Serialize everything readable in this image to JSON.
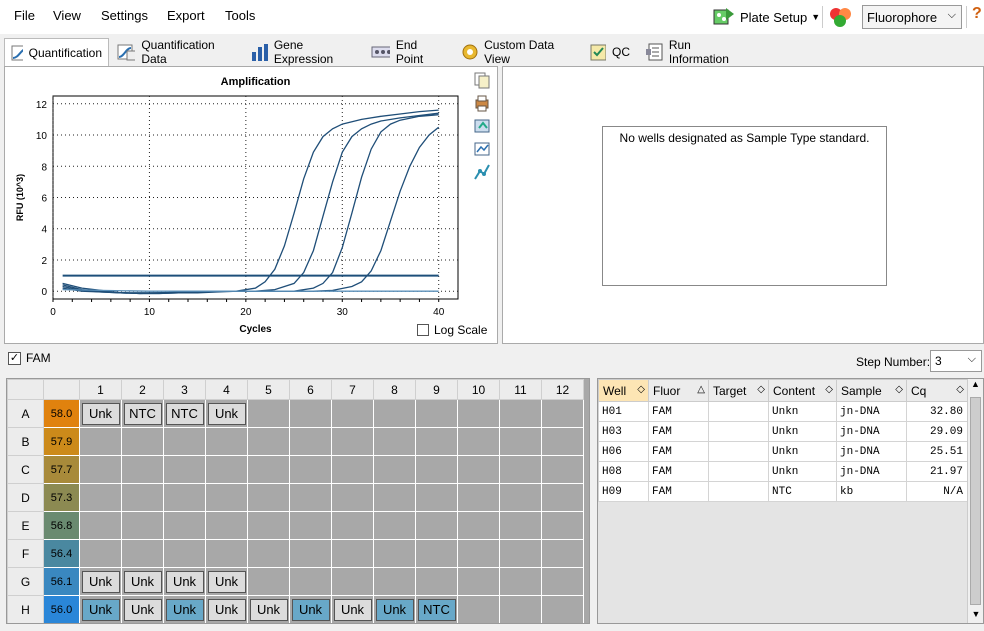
{
  "menu": {
    "items": [
      "File",
      "View",
      "Settings",
      "Export",
      "Tools"
    ]
  },
  "toolbar": {
    "plate_setup": "Plate Setup",
    "fluorophore": "Fluorophore",
    "help": "?"
  },
  "tabs": [
    "Quantification",
    "Quantification Data",
    "Gene Expression",
    "End Point",
    "Custom Data View",
    "QC",
    "Run Information"
  ],
  "chart": {
    "title": "Amplification",
    "xlabel": "Cycles",
    "ylabel": "RFU (10^3)",
    "log_scale": "Log Scale"
  },
  "chart_data": {
    "type": "line",
    "title": "Amplification",
    "xlabel": "Cycles",
    "ylabel": "RFU (10^3)",
    "xlim": [
      0,
      42
    ],
    "ylim": [
      -0.5,
      12.5
    ],
    "xticks": [
      0,
      10,
      20,
      30,
      40
    ],
    "yticks": [
      0,
      2,
      4,
      6,
      8,
      10,
      12
    ],
    "threshold": 1.0,
    "series": [
      {
        "x": [
          1,
          3,
          5,
          7,
          9,
          11,
          13,
          15,
          17,
          19,
          21,
          22,
          23,
          24,
          25,
          26,
          27,
          28,
          29,
          30,
          32,
          34,
          36,
          38,
          40
        ],
        "y": [
          0.5,
          0.2,
          0.05,
          -0.1,
          -0.15,
          -0.15,
          -0.1,
          -0.1,
          -0.05,
          0,
          0.2,
          0.6,
          1.4,
          2.9,
          5.0,
          7.2,
          8.9,
          9.9,
          10.4,
          10.7,
          11.0,
          11.2,
          11.35,
          11.5,
          11.6
        ]
      },
      {
        "x": [
          1,
          3,
          5,
          7,
          9,
          11,
          13,
          15,
          17,
          19,
          21,
          23,
          25,
          26,
          27,
          28,
          29,
          30,
          31,
          32,
          33,
          34,
          36,
          38,
          40
        ],
        "y": [
          0.4,
          0.1,
          0,
          -0.1,
          -0.15,
          -0.15,
          -0.1,
          -0.05,
          0,
          0,
          0,
          0.1,
          0.5,
          1.2,
          2.6,
          4.8,
          7.0,
          8.9,
          9.9,
          10.4,
          10.7,
          10.9,
          11.1,
          11.25,
          11.4
        ]
      },
      {
        "x": [
          1,
          3,
          5,
          7,
          9,
          11,
          13,
          15,
          17,
          19,
          21,
          23,
          25,
          27,
          28,
          29,
          30,
          31,
          32,
          33,
          34,
          35,
          36,
          38,
          40
        ],
        "y": [
          0.3,
          0.05,
          -0.05,
          -0.1,
          -0.15,
          -0.1,
          -0.1,
          -0.05,
          0,
          0,
          0,
          0,
          0,
          0.2,
          0.5,
          1.2,
          2.8,
          5.0,
          7.3,
          9.1,
          10.2,
          10.7,
          10.95,
          11.2,
          11.3
        ]
      },
      {
        "x": [
          1,
          3,
          5,
          7,
          9,
          11,
          13,
          15,
          17,
          19,
          21,
          23,
          25,
          27,
          29,
          31,
          32,
          33,
          34,
          35,
          36,
          37,
          38,
          39,
          40
        ],
        "y": [
          0.2,
          0,
          -0.05,
          -0.1,
          -0.1,
          -0.1,
          -0.05,
          0,
          0,
          0,
          0,
          0,
          0,
          0,
          0.05,
          0.3,
          0.6,
          1.3,
          2.6,
          4.5,
          6.4,
          8.0,
          9.2,
          10.0,
          10.5
        ]
      },
      {
        "x": [
          1,
          5,
          10,
          15,
          20,
          25,
          30,
          35,
          40
        ],
        "y": [
          0.1,
          0.05,
          0,
          0,
          0,
          0,
          0,
          0,
          0
        ]
      }
    ]
  },
  "std_panel": {
    "message": "No wells designated as Sample Type standard."
  },
  "fam": {
    "label": "FAM",
    "step_label": "Step Number:",
    "step_value": "3"
  },
  "plate": {
    "columns": [
      "1",
      "2",
      "3",
      "4",
      "5",
      "6",
      "7",
      "8",
      "9",
      "10",
      "11",
      "12"
    ],
    "rows": [
      {
        "label": "A",
        "temp": "58.0",
        "color": "#e0820e",
        "cells": [
          [
            "Unk",
            "g"
          ],
          [
            "NTC",
            "g"
          ],
          [
            "NTC",
            "g"
          ],
          [
            "Unk",
            "g"
          ],
          null,
          null,
          null,
          null,
          null,
          null,
          null,
          null
        ]
      },
      {
        "label": "B",
        "temp": "57.9",
        "color": "#cc8a1a",
        "cells": [
          null,
          null,
          null,
          null,
          null,
          null,
          null,
          null,
          null,
          null,
          null,
          null
        ]
      },
      {
        "label": "C",
        "temp": "57.7",
        "color": "#a88a3a",
        "cells": [
          null,
          null,
          null,
          null,
          null,
          null,
          null,
          null,
          null,
          null,
          null,
          null
        ]
      },
      {
        "label": "D",
        "temp": "57.3",
        "color": "#8c8a52",
        "cells": [
          null,
          null,
          null,
          null,
          null,
          null,
          null,
          null,
          null,
          null,
          null,
          null
        ]
      },
      {
        "label": "E",
        "temp": "56.8",
        "color": "#6a8a70",
        "cells": [
          null,
          null,
          null,
          null,
          null,
          null,
          null,
          null,
          null,
          null,
          null,
          null
        ]
      },
      {
        "label": "F",
        "temp": "56.4",
        "color": "#4a88a0",
        "cells": [
          null,
          null,
          null,
          null,
          null,
          null,
          null,
          null,
          null,
          null,
          null,
          null
        ]
      },
      {
        "label": "G",
        "temp": "56.1",
        "color": "#3a88c0",
        "cells": [
          [
            "Unk",
            "g"
          ],
          [
            "Unk",
            "g"
          ],
          [
            "Unk",
            "g"
          ],
          [
            "Unk",
            "g"
          ],
          null,
          null,
          null,
          null,
          null,
          null,
          null,
          null
        ]
      },
      {
        "label": "H",
        "temp": "56.0",
        "color": "#2a86d8",
        "cells": [
          [
            "Unk",
            "b"
          ],
          [
            "Unk",
            "g"
          ],
          [
            "Unk",
            "b"
          ],
          [
            "Unk",
            "g"
          ],
          [
            "Unk",
            "g"
          ],
          [
            "Unk",
            "b"
          ],
          [
            "Unk",
            "g"
          ],
          [
            "Unk",
            "b"
          ],
          [
            "NTC",
            "b"
          ],
          null,
          null,
          null
        ]
      }
    ]
  },
  "results": {
    "headers": [
      "Well",
      "Fluor",
      "Target",
      "Content",
      "Sample",
      "Cq"
    ],
    "rows": [
      [
        "H01",
        "FAM",
        "",
        "Unkn",
        "jn-DNA",
        "32.80"
      ],
      [
        "H03",
        "FAM",
        "",
        "Unkn",
        "jn-DNA",
        "29.09"
      ],
      [
        "H06",
        "FAM",
        "",
        "Unkn",
        "jn-DNA",
        "25.51"
      ],
      [
        "H08",
        "FAM",
        "",
        "Unkn",
        "jn-DNA",
        "21.97"
      ],
      [
        "H09",
        "FAM",
        "",
        "NTC",
        "kb",
        "N/A"
      ]
    ]
  }
}
